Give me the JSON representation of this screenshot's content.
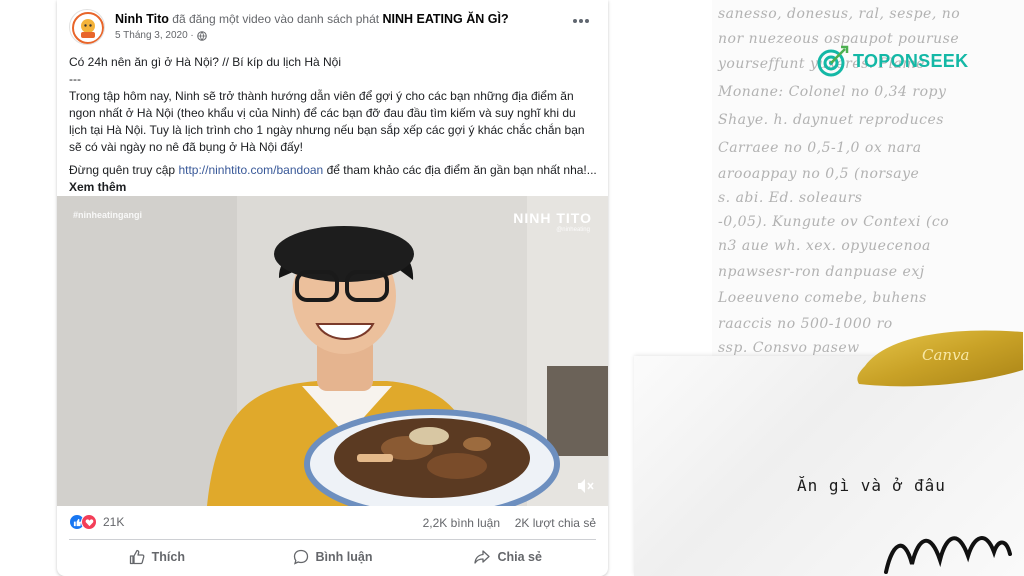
{
  "post": {
    "author": "Ninh Tito",
    "action_text": "đã đăng một video vào danh sách phát",
    "playlist": "NINH EATING ĂN GÌ?",
    "date": "5 Tháng 3, 2020 ·",
    "title_line": "Có 24h nên ăn gì ở Hà Nội? // Bí kíp du lịch Hà Nội",
    "separator": "---",
    "body_paragraph": "Trong tập hôm nay, Ninh sẽ trở thành hướng dẫn viên để gợi ý cho các bạn những địa điểm ăn ngon nhất ở Hà Nội (theo khẩu vị của Ninh) để các bạn đỡ đau đầu tìm kiếm và suy nghĩ khi du lịch tại Hà Nội. Tuy là lịch trình cho 1 ngày nhưng nếu bạn sắp xếp các gợi ý khác chắc chắn bạn sẽ có vài ngày no nê đã bụng ở Hà Nội đấy!",
    "cta_prefix": "Đừng quên truy cập",
    "cta_link": "http://ninhtito.com/bandoan",
    "cta_suffix": "để tham khảo các địa điểm ăn gần bạn nhất nha!...",
    "see_more": "Xem thêm"
  },
  "video": {
    "watermark_left": "#ninheatingangi",
    "watermark_right": "NINH TITO",
    "watermark_sub": "@ninheating"
  },
  "stats": {
    "reactions": "21K",
    "comments": "2,2K bình luận",
    "shares": "2K lượt chia sẻ"
  },
  "actions": {
    "like": "Thích",
    "comment": "Bình luận",
    "share": "Chia sẻ"
  },
  "decoration": {
    "brand": "TOPONSEEK",
    "canva": "Canva",
    "caption": "Ăn gì và ở đâu",
    "manuscript_lines": [
      "sanesso, donesus, ral, sespe, no",
      "nor nuezeous ospaupot pouruse",
      "yourseffunt yuxeres. Plame",
      "Monane: Colonel no 0,34 ropy",
      "Shaye.  h. daynuet reproduces",
      "Carraee no 0,5-1,0 ox nara",
      "arooappay no 0,5 (norsaye",
      "s.     abi. Ed. soleaurs",
      "-0,05). Kungute ov Contexi (co",
      "n3 aue wh. xex. opyuecenoa",
      "npawsesr-ron danpuase   exj",
      "Loeeuveno comebe, buhens",
      "raaccis no 500-1000 ro",
      "ssp. Consvo pasew"
    ]
  },
  "colors": {
    "fb_link": "#385898",
    "like_blue": "#1877f2",
    "love_red": "#f33e58",
    "brand_teal": "#14b8a6",
    "gold": "#c9a227"
  }
}
